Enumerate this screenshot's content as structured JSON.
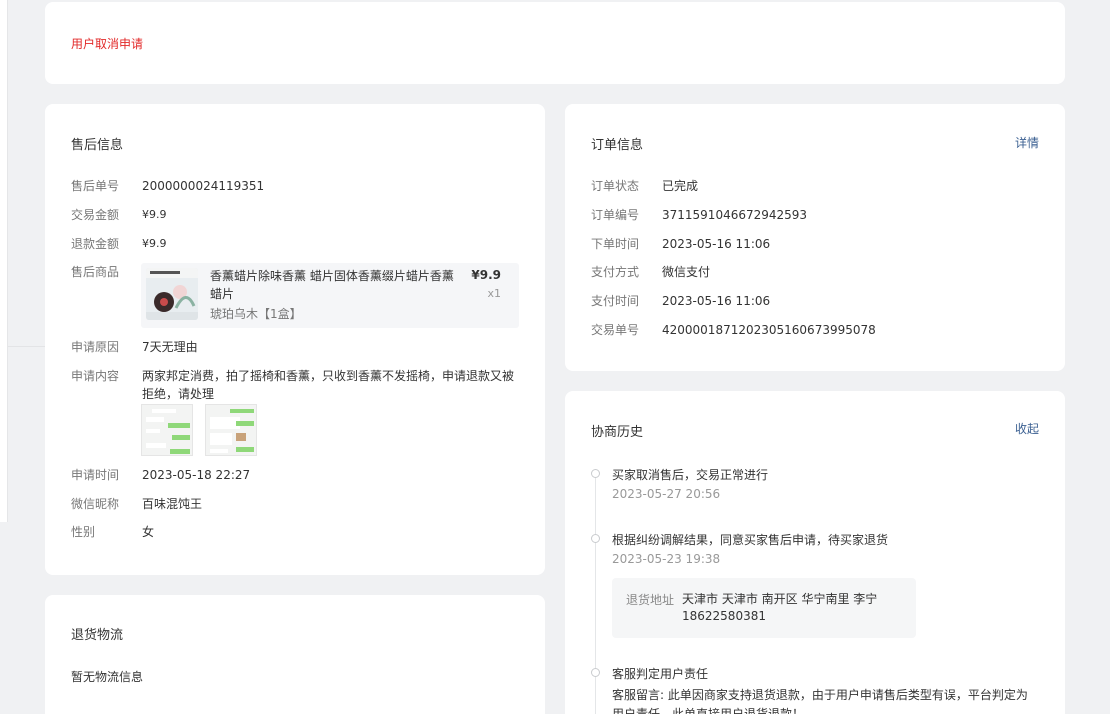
{
  "status_card": {
    "text": "用户取消申请"
  },
  "aftersale": {
    "title": "售后信息",
    "rows": [
      {
        "label": "售后单号",
        "value": "2000000024119351"
      },
      {
        "label": "交易金额",
        "value": "¥9.9"
      },
      {
        "label": "退款金额",
        "value": "¥9.9"
      }
    ],
    "product_label": "售后商品",
    "product": {
      "name": "香薰蜡片除味香薰 蜡片固体香薰缀片蜡片香薰 蜡片",
      "sku": "琥珀乌木【1盒】",
      "price": "¥9.9",
      "qty": "x1"
    },
    "reason_label": "申请原因",
    "reason": "7天无理由",
    "content_label": "申请内容",
    "content": "两家邦定消费，拍了摇椅和香薰，只收到香薰不发摇椅，申请退款又被拒绝，请处理",
    "rows2": [
      {
        "label": "申请时间",
        "value": "2023-05-18 22:27"
      },
      {
        "label": "微信昵称",
        "value": "百味混饨王"
      },
      {
        "label": "性别",
        "value": "女"
      }
    ]
  },
  "order": {
    "title": "订单信息",
    "link": "详情",
    "rows": [
      {
        "label": "订单状态",
        "value": "已完成"
      },
      {
        "label": "订单编号",
        "value": "3711591046672942593"
      },
      {
        "label": "下单时间",
        "value": "2023-05-16 11:06"
      },
      {
        "label": "支付方式",
        "value": "微信支付"
      },
      {
        "label": "支付时间",
        "value": "2023-05-16 11:06"
      },
      {
        "label": "交易单号",
        "value": "4200001871202305160673995078"
      }
    ]
  },
  "logistics": {
    "title": "退货物流",
    "empty": "暂无物流信息"
  },
  "history": {
    "title": "协商历史",
    "link": "收起",
    "events": [
      {
        "title": "买家取消售后，交易正常进行",
        "time": "2023-05-27 20:56"
      },
      {
        "title": "根据纠纷调解结果，同意买家售后申请，待买家退货",
        "time": "2023-05-23 19:38",
        "addr_label": "退货地址",
        "addr": "天津市 天津市 南开区 华宁南里 李宁",
        "phone": "18622580381"
      },
      {
        "title": "客服判定用户责任",
        "message": "客服留言: 此单因商家支持退货退款，由于用户申请售后类型有误，平台判定为用户责任，此单直接用户退货退款！"
      }
    ]
  }
}
